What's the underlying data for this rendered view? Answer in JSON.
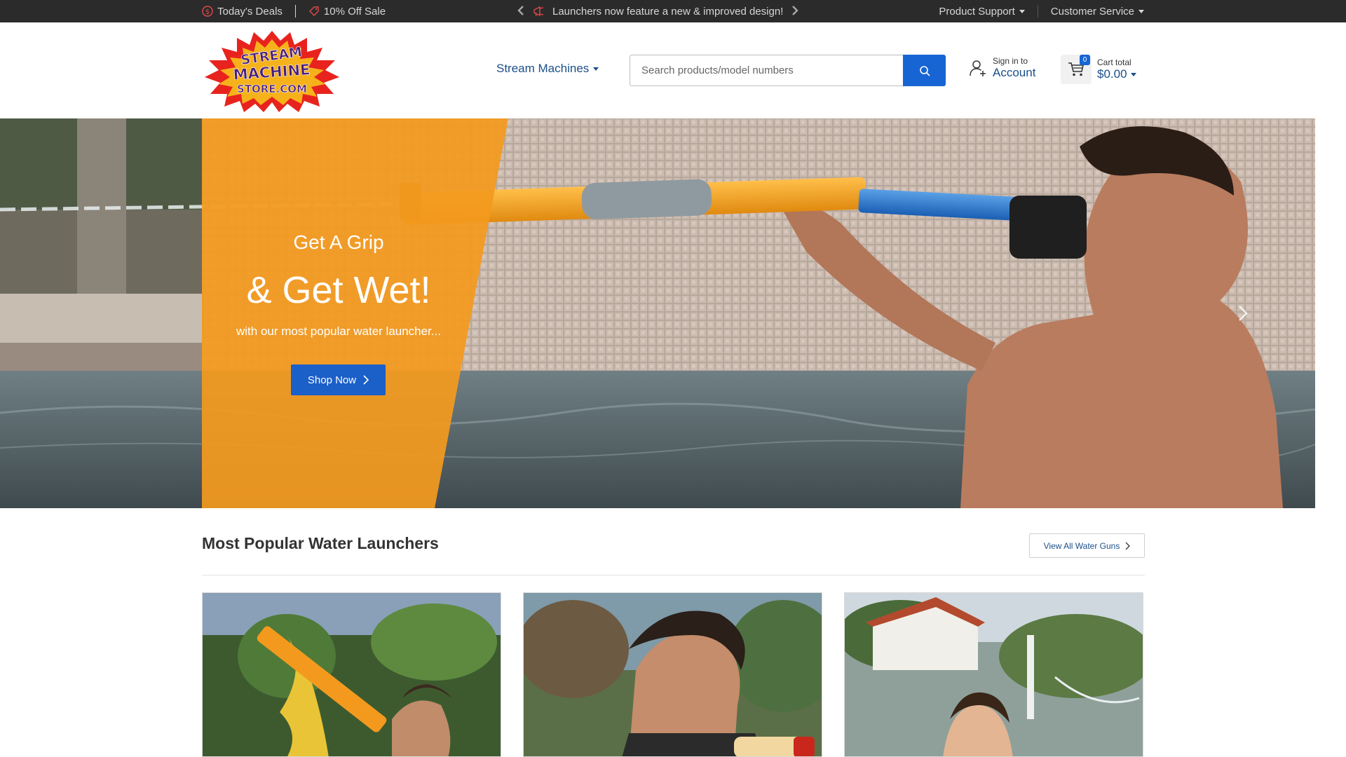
{
  "topbar": {
    "deals_label": "Today's Deals",
    "sale_label": "10% Off Sale",
    "announcement": "Launchers now feature a new & improved design!",
    "product_support": "Product Support",
    "customer_service": "Customer Service"
  },
  "header": {
    "logo_text": [
      "STREAM",
      "MACHINE",
      "STORE.COM"
    ],
    "nav_dropdown": "Stream Machines",
    "search_placeholder": "Search products/model numbers",
    "account_small": "Sign in to",
    "account_big": "Account",
    "cart_count": "0",
    "cart_small": "Cart total",
    "cart_total": "$0.00"
  },
  "hero": {
    "subtitle": "Get A Grip",
    "title": "& Get Wet!",
    "description": "with our most popular water launcher...",
    "button_label": "Shop Now"
  },
  "section": {
    "title": "Most Popular Water Launchers",
    "view_all_label": "View All Water Guns"
  },
  "colors": {
    "topbar_bg": "#2b2b2b",
    "brand_blue": "#1765d4",
    "link_blue": "#1b4f8a",
    "hero_orange": "#f39a1e"
  }
}
